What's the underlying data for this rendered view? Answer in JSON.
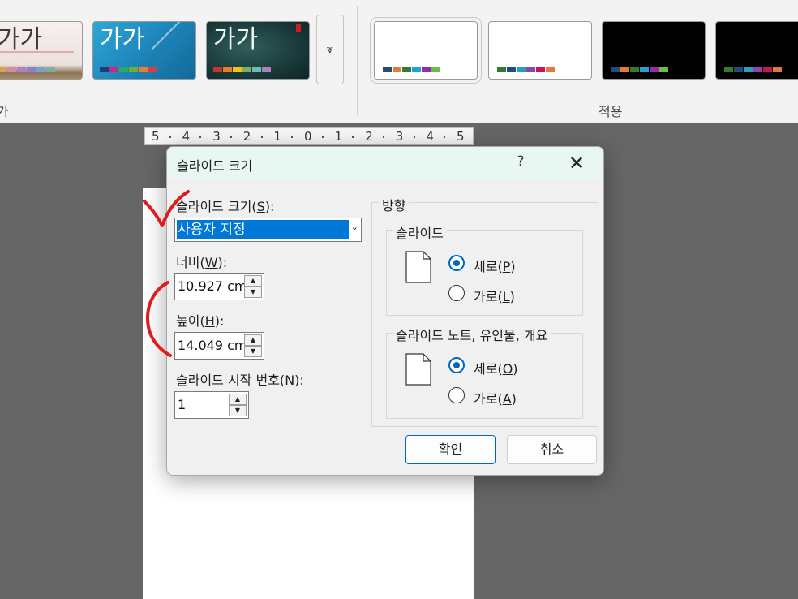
{
  "ribbon": {
    "theme_sample_text": "가가",
    "group_left_label": "가",
    "group_apply_label": "적용",
    "more_glyph": "⩔",
    "theme_swatches": [
      [
        "#d8a05a",
        "#d78aa0",
        "#b07fbf",
        "#8e7fc9",
        "#7aa0c8",
        "#7ab0a0"
      ],
      [
        "#1b3f7a",
        "#c32a85",
        "#2aa86a",
        "#6ab12c",
        "#e8822a",
        "#d64040"
      ],
      [
        "#c0392b",
        "#e67e22",
        "#f1c40f",
        "#7fb069",
        "#6cbcb0",
        "#b07fbf"
      ]
    ],
    "variant_swatches": [
      [
        "#1f4e79",
        "#e07b39",
        "#2e7d32",
        "#1ea3d9",
        "#9c27b0",
        "#6abf40"
      ],
      [
        "#2e7d32",
        "#1f4e79",
        "#2a9fbc",
        "#8e44ad",
        "#c2185b",
        "#e07b39"
      ],
      [
        "#1f4e79",
        "#e07b39",
        "#2e7d32",
        "#1ea3d9",
        "#9c27b0",
        "#6abf40"
      ],
      [
        "#2e7d32",
        "#1f4e79",
        "#2a9fbc",
        "#8e44ad",
        "#c2185b",
        "#e07b39"
      ]
    ]
  },
  "ruler": {
    "labels": [
      "5",
      "4",
      "3",
      "2",
      "1",
      "0",
      "1",
      "2",
      "3",
      "4",
      "5"
    ]
  },
  "dialog": {
    "title": "슬라이드 크기",
    "help": "?",
    "close": "✕",
    "slide_size": {
      "label": "슬라이드 크기(",
      "key": "S",
      "suffix": "):",
      "value": "사용자 지정",
      "arrow": "⌄"
    },
    "width": {
      "label": "너비(",
      "key": "W",
      "suffix": "):",
      "value": "10.927 cm"
    },
    "height": {
      "label": "높이(",
      "key": "H",
      "suffix": "):",
      "value": "14.049 cm"
    },
    "start_number": {
      "label": "슬라이드 시작 번호(",
      "key": "N",
      "suffix": "):",
      "value": "1"
    },
    "spin_up": "▲",
    "spin_down": "▼",
    "orientation": {
      "title": "방향",
      "slides": {
        "title": "슬라이드",
        "portrait": {
          "label": "세로(",
          "key": "P",
          "suffix": ")",
          "checked": true
        },
        "landscape": {
          "label": "가로(",
          "key": "L",
          "suffix": ")",
          "checked": false
        }
      },
      "notes": {
        "title": "슬라이드 노트, 유인물, 개요",
        "portrait": {
          "label": "세로(",
          "key": "O",
          "suffix": ")",
          "checked": true
        },
        "landscape": {
          "label": "가로(",
          "key": "A",
          "suffix": ")",
          "checked": false
        }
      }
    },
    "ok_label": "확인",
    "cancel_label": "취소"
  },
  "colors": {
    "accent": "#0067c0",
    "selection": "#0078d7",
    "annotation": "#e01b1b"
  }
}
